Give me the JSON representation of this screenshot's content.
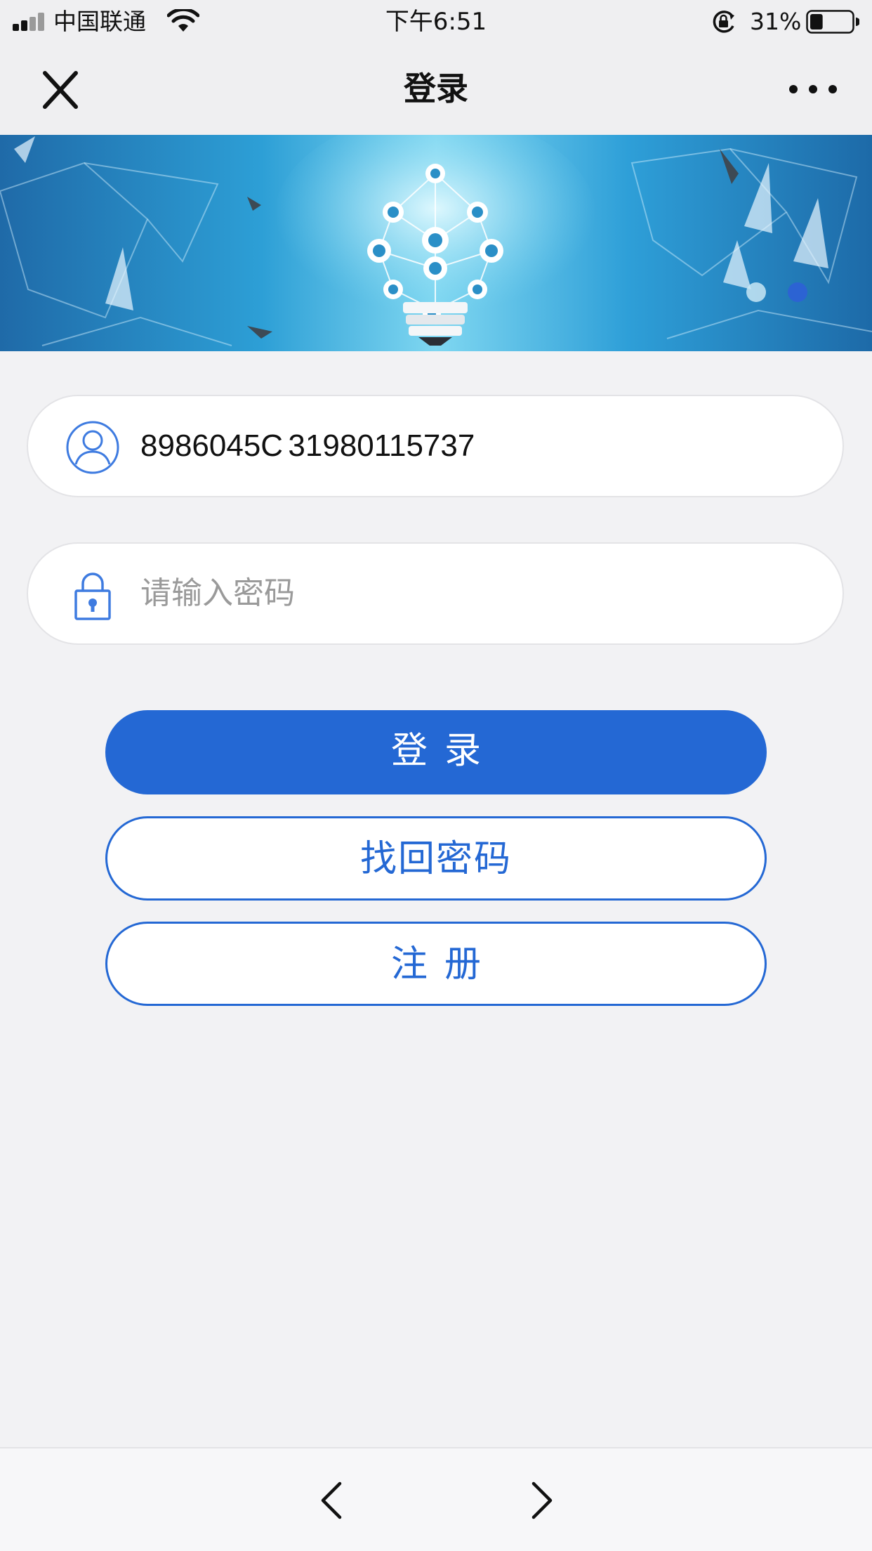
{
  "status_bar": {
    "carrier": "中国联通",
    "time": "下午6:51",
    "battery_percent": "31%",
    "battery_level": 0.31,
    "icons": [
      "signal-icon",
      "wifi-icon",
      "orientation-lock-icon",
      "battery-icon"
    ]
  },
  "nav": {
    "title": "登录",
    "close_icon": "close-icon",
    "more_icon": "more-icon"
  },
  "banner": {
    "slides": 2,
    "active_slide": 2
  },
  "form": {
    "username_value": "8986045C  31980115737",
    "password_placeholder": "请输入密码",
    "user_icon": "user-icon",
    "lock_icon": "lock-icon"
  },
  "buttons": {
    "login": "登录",
    "recover": "找回密码",
    "register": "注册"
  },
  "toolbar": {
    "back_icon": "chevron-left-icon",
    "forward_icon": "chevron-right-icon"
  },
  "colors": {
    "accent": "#2468d4",
    "background": "#f2f2f4",
    "field_border": "#e3e3e6",
    "placeholder": "#9a9a9a"
  }
}
